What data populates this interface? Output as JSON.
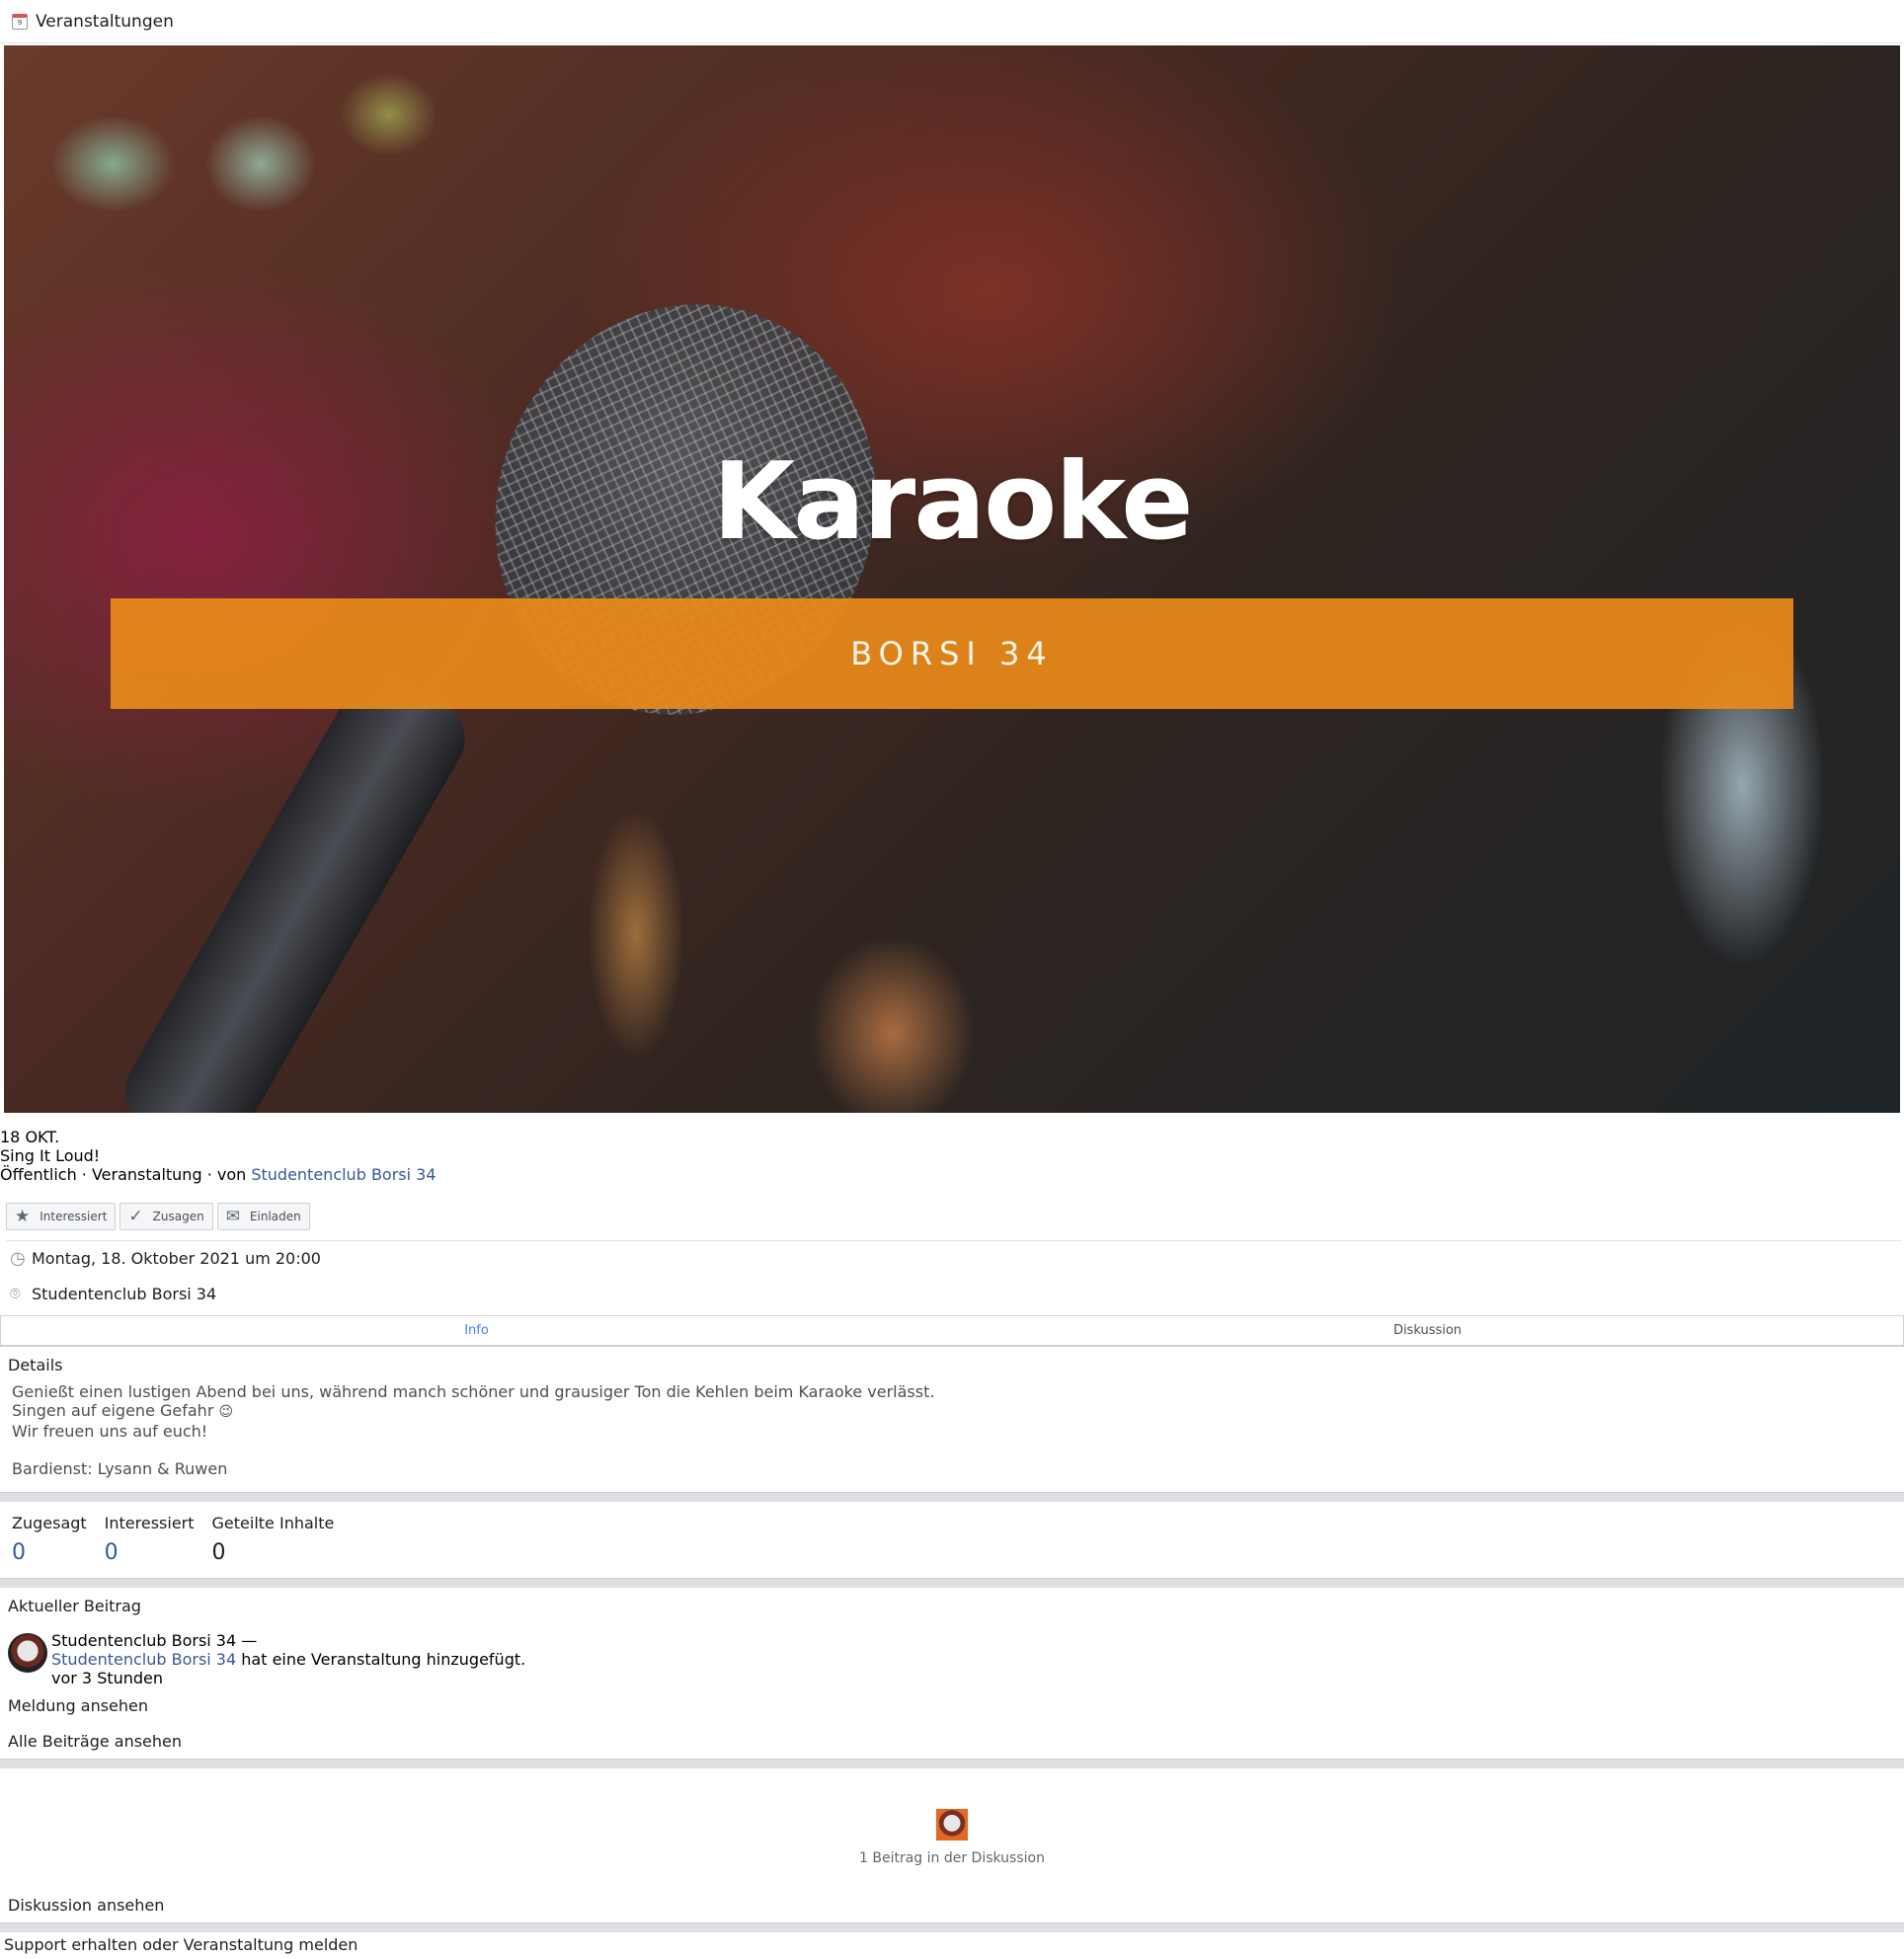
{
  "topbar": {
    "icon": "calendar-icon",
    "title": "Veranstaltungen"
  },
  "cover": {
    "title": "Karaoke",
    "band_text": "BORSI 34"
  },
  "event": {
    "date": "18 OKT.",
    "name": "Sing It Loud!",
    "meta_prefix": "Öffentlich · Veranstaltung · von ",
    "organizer": "Studentenclub Borsi 34"
  },
  "buttons": [
    {
      "label": "Interessiert",
      "icon": "star-icon"
    },
    {
      "label": "Zusagen",
      "icon": "check-icon"
    },
    {
      "label": "Einladen",
      "icon": "envelope-icon"
    }
  ],
  "info": {
    "datetime": "Montag, 18. Oktober 2021 um 20:00",
    "location": "Studentenclub Borsi 34"
  },
  "tabs": [
    {
      "label": "Info",
      "active": true
    },
    {
      "label": "Diskussion",
      "active": false
    }
  ],
  "details": {
    "title": "Details",
    "line1": "Genießt einen lustigen Abend bei uns, während manch schöner und grausiger Ton die Kehlen beim Karaoke verlässt.",
    "line2": "Singen auf eigene Gefahr",
    "line2_emoji": "😉",
    "line3": "Wir freuen uns auf euch!",
    "line4": "Bardienst: Lysann & Ruwen"
  },
  "stats": [
    {
      "label": "Zugesagt",
      "value": "0"
    },
    {
      "label": "Interessiert",
      "value": "0"
    },
    {
      "label": "Geteilte Inhalte",
      "value": "0"
    }
  ],
  "recent": {
    "title": "Aktueller Beitrag",
    "author_line": "Studentenclub Borsi 34 —",
    "author_link": "Studentenclub Borsi 34",
    "action": " hat eine Veranstaltung hinzugefügt.",
    "time": "vor 3 Stunden",
    "view_post": "Meldung ansehen",
    "view_all": "Alle Beiträge ansehen"
  },
  "discussion": {
    "count_text": "1 Beitrag in der Diskussion",
    "view": "Diskussion ansehen"
  },
  "footer": {
    "support": "Support erhalten oder Veranstaltung melden"
  },
  "colors": {
    "link": "#385898",
    "accent": "#ea8a1a",
    "tab_active": "#4080ff"
  }
}
